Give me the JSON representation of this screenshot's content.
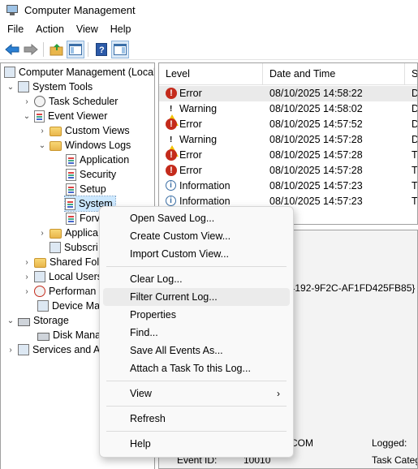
{
  "window": {
    "title": "Computer Management"
  },
  "menubar": [
    "File",
    "Action",
    "View",
    "Help"
  ],
  "toolbar": {
    "buttons": [
      "back-icon",
      "forward-icon",
      "up-folder-icon",
      "show-hide-console-tree-icon",
      "help-icon",
      "show-hide-action-pane-icon"
    ]
  },
  "tree": {
    "root": "Computer Management (Local",
    "system_tools": "System Tools",
    "task_scheduler": "Task Scheduler",
    "event_viewer": "Event Viewer",
    "custom_views": "Custom Views",
    "windows_logs": "Windows Logs",
    "application": "Application",
    "security": "Security",
    "setup": "Setup",
    "system": "System",
    "forwarded": "Forv",
    "applications_services": "Applica",
    "subscriptions": "Subscri",
    "shared_folders": "Shared Fold",
    "local_users": "Local Users",
    "performance": "Performan",
    "device_manager": "Device Mar",
    "storage": "Storage",
    "disk_management": "Disk Manag",
    "services_apps": "Services and A"
  },
  "events": {
    "columns": [
      "Level",
      "Date and Time",
      "S"
    ],
    "rows": [
      {
        "level": "Error",
        "icon": "error-icon",
        "datetime": "08/10/2025 14:58:22",
        "source": "D"
      },
      {
        "level": "Warning",
        "icon": "warning-icon",
        "datetime": "08/10/2025 14:58:02",
        "source": "D"
      },
      {
        "level": "Error",
        "icon": "error-icon",
        "datetime": "08/10/2025 14:57:52",
        "source": "D"
      },
      {
        "level": "Warning",
        "icon": "warning-icon",
        "datetime": "08/10/2025 14:57:28",
        "source": "D"
      },
      {
        "level": "Error",
        "icon": "error-icon",
        "datetime": "08/10/2025 14:57:28",
        "source": "T"
      },
      {
        "level": "Error",
        "icon": "error-icon",
        "datetime": "08/10/2025 14:57:28",
        "source": "T"
      },
      {
        "level": "Information",
        "icon": "info-icon",
        "datetime": "08/10/2025 14:57:23",
        "source": "T"
      },
      {
        "level": "Information",
        "icon": "info-icon",
        "datetime": "08/10/2025 14:57:23",
        "source": "T"
      }
    ]
  },
  "details": {
    "guid_fragment": "3-4192-9F2C-AF1FD425FB85} c",
    "computer_fragment": "COM",
    "logged_label": "Logged:",
    "event_id_label": "Event ID:",
    "event_id_value": "10010",
    "task_category_label": "Task Categ"
  },
  "context_menu": {
    "items": [
      "Open Saved Log...",
      "Create Custom View...",
      "Import Custom View...",
      "Clear Log...",
      "Filter Current Log...",
      "Properties",
      "Find...",
      "Save All Events As...",
      "Attach a Task To this Log...",
      "View",
      "Refresh",
      "Help"
    ]
  }
}
